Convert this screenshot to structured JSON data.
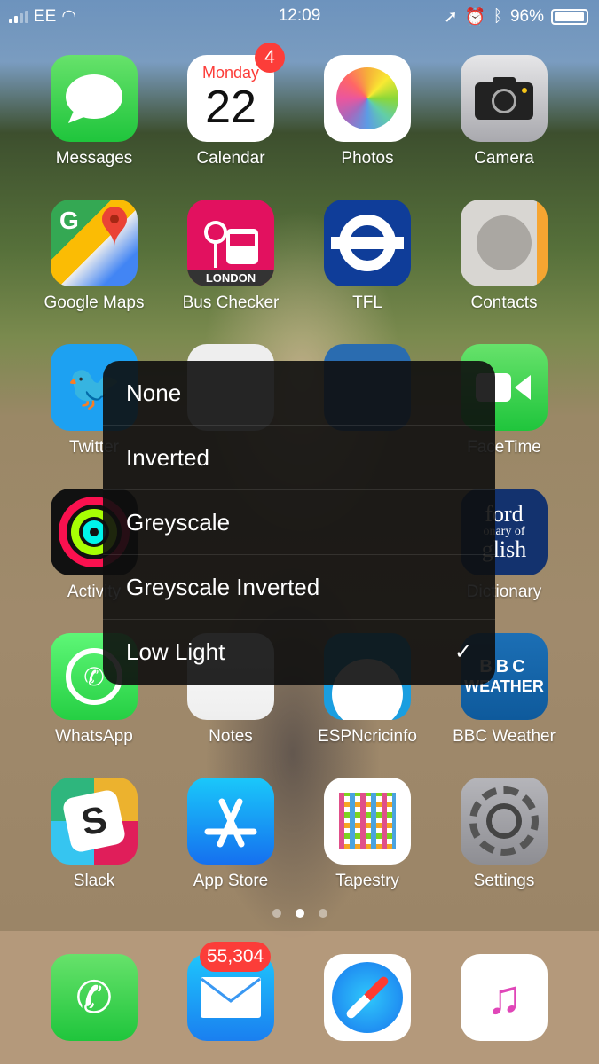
{
  "status": {
    "carrier": "EE",
    "time": "12:09",
    "battery": "96%",
    "battery_level": 0.96
  },
  "apps": [
    {
      "name": "Messages",
      "icon": "messages-icon",
      "color": "#34c759"
    },
    {
      "name": "Calendar",
      "icon": "calendar-icon",
      "day": "Monday",
      "date": "22",
      "badge": "4"
    },
    {
      "name": "Photos",
      "icon": "photos-icon"
    },
    {
      "name": "Camera",
      "icon": "camera-icon"
    },
    {
      "name": "Google Maps",
      "icon": "google-maps-icon"
    },
    {
      "name": "Bus Checker",
      "icon": "bus-checker-icon",
      "sub": "LONDON"
    },
    {
      "name": "TFL",
      "icon": "tfl-roundel-icon"
    },
    {
      "name": "Contacts",
      "icon": "contacts-icon"
    },
    {
      "name": "Twitter",
      "icon": "twitter-icon"
    },
    {
      "name": "FaceTime",
      "icon": "facetime-icon"
    },
    {
      "name": "Activity",
      "icon": "activity-icon"
    },
    {
      "name": "Dictionary",
      "icon": "dictionary-icon",
      "art": [
        "ford",
        "onary of",
        "glish"
      ]
    },
    {
      "name": "WhatsApp",
      "icon": "whatsapp-icon"
    },
    {
      "name": "Notes",
      "icon": "notes-icon"
    },
    {
      "name": "ESPNcricinfo",
      "icon": "espncricinfo-icon"
    },
    {
      "name": "BBC Weather",
      "icon": "bbc-weather-icon",
      "art": [
        "BBC",
        "WEATHER"
      ]
    },
    {
      "name": "Slack",
      "icon": "slack-icon"
    },
    {
      "name": "App Store",
      "icon": "app-store-icon"
    },
    {
      "name": "Tapestry",
      "icon": "tapestry-icon"
    },
    {
      "name": "Settings",
      "icon": "settings-icon"
    }
  ],
  "menu": {
    "options": [
      "None",
      "Inverted",
      "Greyscale",
      "Greyscale Inverted",
      "Low Light"
    ],
    "selected": "Low Light"
  },
  "pages": {
    "count": 3,
    "current": 2
  },
  "dock": {
    "mail_badge": "55,304",
    "apps": [
      "phone-icon",
      "mail-icon",
      "safari-icon",
      "music-icon"
    ]
  }
}
